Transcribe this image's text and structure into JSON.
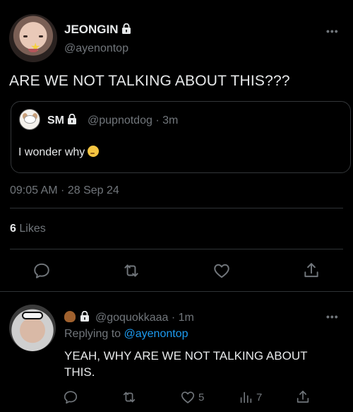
{
  "main_tweet": {
    "author_name": "JEONGIN",
    "handle": "@ayenontop",
    "text": "ARE WE NOT TALKING ABOUT THIS???",
    "more": "•••",
    "timestamp": "09:05 AM · 28 Sep 24",
    "likes_count": "6",
    "likes_label": "Likes",
    "quoted": {
      "author_name": "SM",
      "handle": "@pupnotdog · 3m",
      "text": "I wonder why"
    },
    "actions": [
      "reply-icon",
      "retweet-icon",
      "like-icon",
      "share-icon"
    ]
  },
  "reply_tweet": {
    "handle": "@goquokkaaa · 1m",
    "replying_prefix": "Replying to",
    "replying_to": "@ayenontop",
    "text": "YEAH, WHY ARE WE NOT TALKING ABOUT THIS.",
    "more": "•••",
    "like_count": "5",
    "views_count": "7"
  },
  "colors": {
    "background": "#000000",
    "text": "#e7e9ea",
    "muted": "#71767b",
    "accent": "#1d9bf0",
    "border": "#2f3336"
  }
}
